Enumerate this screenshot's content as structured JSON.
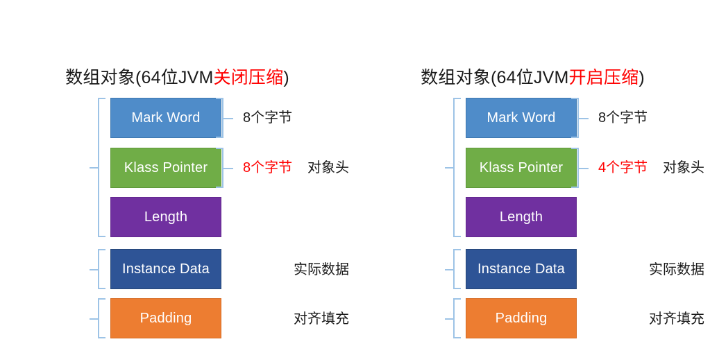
{
  "diagram": {
    "title_prefix": "数组对象(64位JVM",
    "title_suffix": ")",
    "colors": {
      "mark_word": "#4F8CC9",
      "klass_pointer": "#70AD47",
      "length": "#7030A0",
      "instance_data": "#2E5496",
      "padding": "#ED7D31",
      "brace": "#9DC3E6",
      "highlight": "#FF0000",
      "text": "#1A1A1A"
    }
  },
  "panels": [
    {
      "id": "uncompressed",
      "title_prefix": "数组对象(64位JVM",
      "title_highlight": "关闭压缩",
      "title_suffix": ")",
      "groups": {
        "header_label": "对象头",
        "instance_label": "实际数据",
        "padding_label": "对齐填充"
      },
      "boxes": {
        "mark_word": "Mark Word",
        "klass_pointer": "Klass Pointer",
        "length": "Length",
        "instance_data": "Instance Data",
        "padding": "Padding"
      },
      "sizes": {
        "mark_word": "8个字节",
        "klass_pointer": "8个字节"
      }
    },
    {
      "id": "compressed",
      "title_prefix": "数组对象(64位JVM",
      "title_highlight": "开启压缩",
      "title_suffix": ")",
      "groups": {
        "header_label": "对象头",
        "instance_label": "实际数据",
        "padding_label": "对齐填充"
      },
      "boxes": {
        "mark_word": "Mark Word",
        "klass_pointer": "Klass Pointer",
        "length": "Length",
        "instance_data": "Instance Data",
        "padding": "Padding"
      },
      "sizes": {
        "mark_word": "8个字节",
        "klass_pointer": "4个字节"
      }
    }
  ]
}
